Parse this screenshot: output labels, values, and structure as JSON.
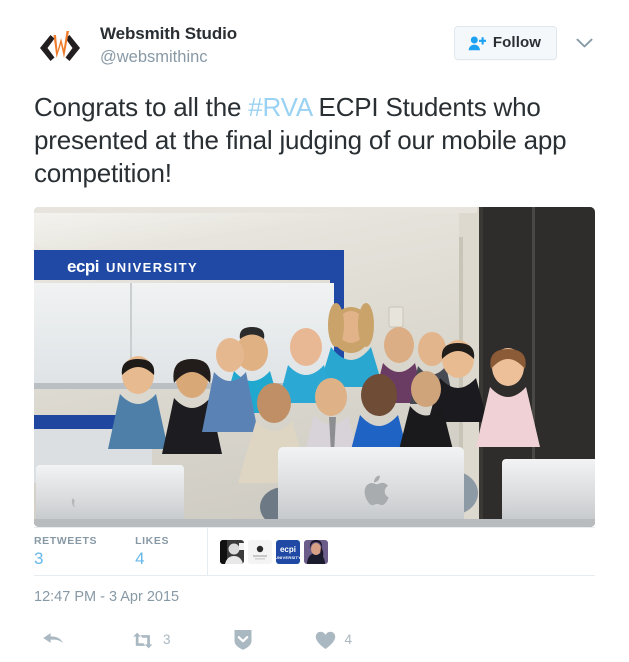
{
  "tweet": {
    "author": {
      "display_name": "Websmith Studio",
      "handle": "@websmithinc",
      "avatar_icon": "websmith-logo-angle-bracket-w",
      "avatar_bracket_color": "#231f20",
      "avatar_w_color": "#f07c2b"
    },
    "follow": {
      "label": "Follow",
      "icon": "follow-person-plus-icon",
      "icon_color": "#1da1f2",
      "caret_icon": "chevron-down-icon"
    },
    "body": {
      "text_before_hashtag": "Congrats to all the ",
      "hashtag": "#RVA",
      "hashtag_color": "#9ad2f3",
      "text_after_hashtag": " ECPI Students who presented at the final judging of our mobile app competition!"
    },
    "photo": {
      "alt": "Group of ECPI University students and instructors posing in a computer lab in front of iMac computers, beneath an ecpi UNIVERSITY banner",
      "banner_text_brand": "ecpi",
      "banner_text_word": "UNIVERSITY",
      "banner_color": "#1f49a4",
      "wall_color": "#d8d5cc",
      "whiteboard_color": "#e9ecee"
    },
    "stats": [
      {
        "label": "RETWEETS",
        "value": "3"
      },
      {
        "label": "LIKES",
        "value": "4"
      }
    ],
    "facepile": [
      {
        "name": "avatar-thumb-1",
        "kind": "grayscale-portrait"
      },
      {
        "name": "avatar-thumb-2",
        "kind": "white-logo"
      },
      {
        "name": "avatar-thumb-3",
        "kind": "ecpi-logo",
        "brand": "ecpi",
        "word": "UNIVERSITY"
      },
      {
        "name": "avatar-thumb-4",
        "kind": "portrait"
      }
    ],
    "timestamp": "12:47 PM - 3 Apr 2015",
    "actions": [
      {
        "name": "reply",
        "icon": "reply-arrow-icon",
        "count": ""
      },
      {
        "name": "retweet",
        "icon": "retweet-icon",
        "count": "3"
      },
      {
        "name": "more",
        "icon": "more-shield-chevron-icon",
        "count": ""
      },
      {
        "name": "like",
        "icon": "heart-icon",
        "count": "4"
      }
    ]
  }
}
